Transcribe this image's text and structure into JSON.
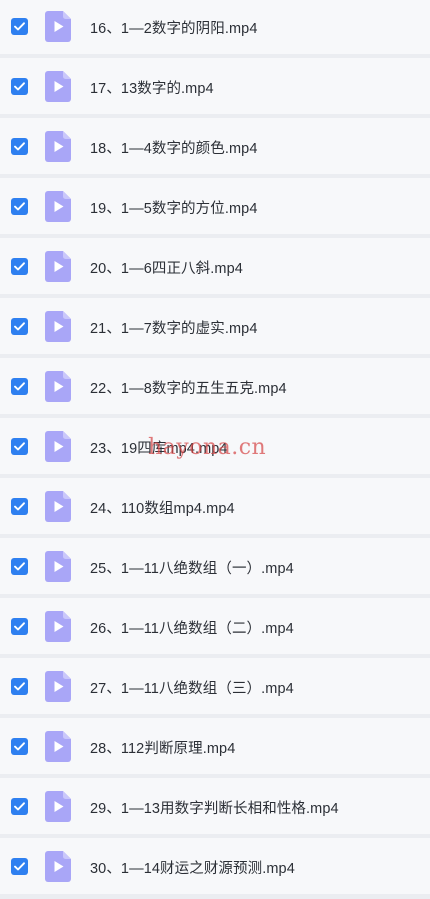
{
  "colors": {
    "checkbox_checked": "#2f80f0",
    "file_icon": "#a9a6f7",
    "row_background": "#f7f8fa",
    "separator": "#ebedf1",
    "text": "#2b2f36",
    "watermark": "#d64848"
  },
  "icons": {
    "checkbox": "checkmark-icon",
    "file": "video-file-icon"
  },
  "files": [
    {
      "name": "16、1—2数字的阴阳.mp4",
      "checked": true
    },
    {
      "name": "17、13数字的.mp4",
      "checked": true
    },
    {
      "name": "18、1—4数字的颜色.mp4",
      "checked": true
    },
    {
      "name": "19、1—5数字的方位.mp4",
      "checked": true
    },
    {
      "name": "20、1—6四正八斜.mp4",
      "checked": true
    },
    {
      "name": "21、1—7数字的虚实.mp4",
      "checked": true
    },
    {
      "name": "22、1—8数字的五生五克.mp4",
      "checked": true
    },
    {
      "name": "23、19四库mp4.mp4",
      "checked": true
    },
    {
      "name": "24、110数组mp4.mp4",
      "checked": true
    },
    {
      "name": "25、1—11八绝数组（一）.mp4",
      "checked": true
    },
    {
      "name": "26、1—11八绝数组（二）.mp4",
      "checked": true
    },
    {
      "name": "27、1—11八绝数组（三）.mp4",
      "checked": true
    },
    {
      "name": "28、112判断原理.mp4",
      "checked": true
    },
    {
      "name": "29、1—13用数字判断长相和性格.mp4",
      "checked": true
    },
    {
      "name": "30、1—14财运之财源预测.mp4",
      "checked": true
    }
  ],
  "watermark": "hayona.cn"
}
